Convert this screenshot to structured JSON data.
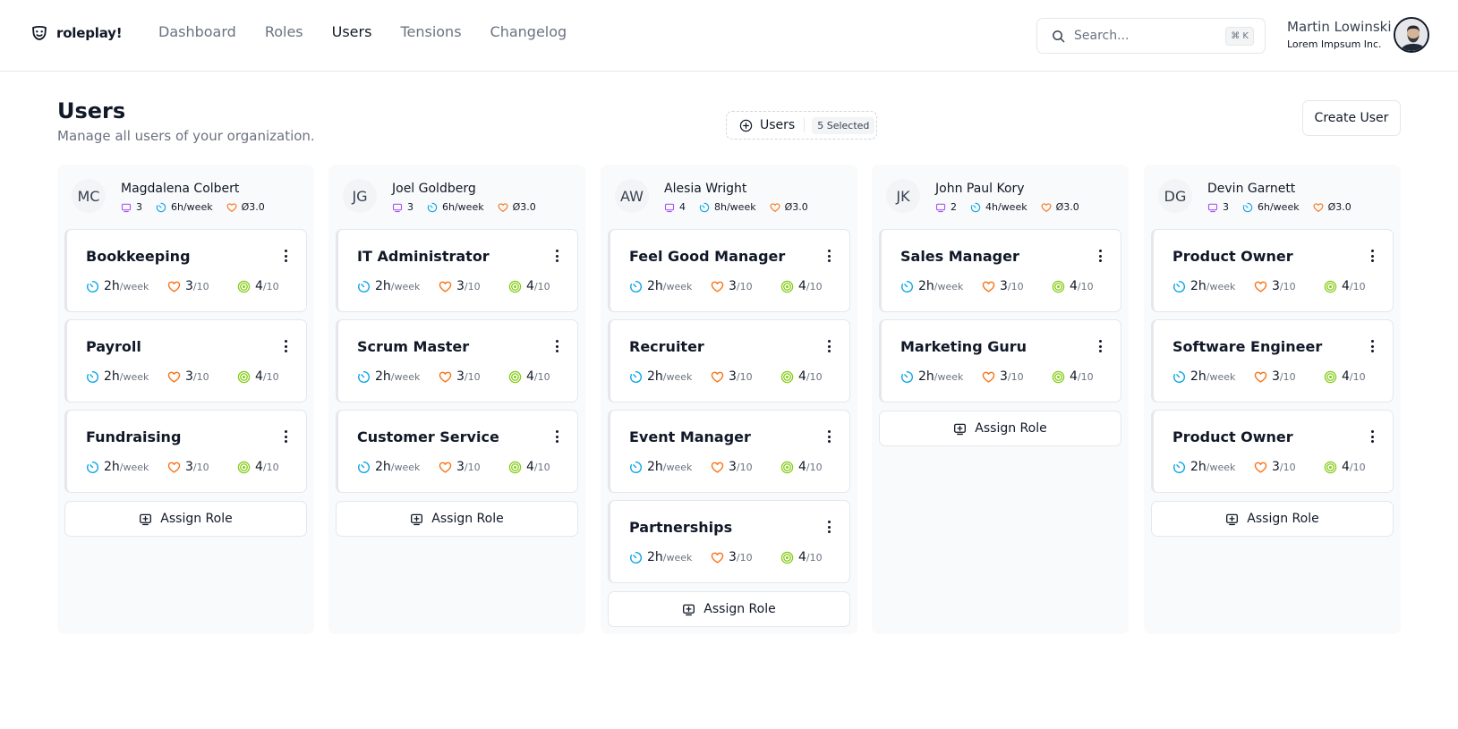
{
  "app": {
    "name": "roleplay!"
  },
  "nav": {
    "items": [
      {
        "label": "Dashboard"
      },
      {
        "label": "Roles"
      },
      {
        "label": "Users",
        "active": true
      },
      {
        "label": "Tensions"
      },
      {
        "label": "Changelog"
      }
    ]
  },
  "search": {
    "placeholder": "Search...",
    "shortcut": "⌘ K"
  },
  "current_user": {
    "name": "Martin Lowinski",
    "org": "Lorem Impsum Inc."
  },
  "page": {
    "title": "Users",
    "subtitle": "Manage all users of your organization.",
    "filter_label": "Users",
    "filter_badge": "5 Selected",
    "create_button": "Create User",
    "assign_label": "Assign Role"
  },
  "colors": {
    "roles_icon": "#a855f7",
    "time_icon": "#0ea5e9",
    "love_icon": "#f97316",
    "target_icon": "#84cc16"
  },
  "icons": {
    "logo": "mask-icon",
    "search": "search-icon",
    "filter": "plus-circle-icon",
    "roles": "roles-icon",
    "time": "clock-icon",
    "love": "heart-icon",
    "target": "target-icon",
    "menu": "more-vertical-icon",
    "assign": "assign-role-icon"
  },
  "columns": [
    {
      "initials": "MC",
      "name": "Magdalena Colbert",
      "role_count": "3",
      "hours": "6h/week",
      "avg": "Ø3.0",
      "roles": [
        {
          "title": "Bookkeeping",
          "hours": "2h",
          "unit": "/week",
          "love": "3",
          "love_max": "/10",
          "fit": "4",
          "fit_max": "/10"
        },
        {
          "title": "Payroll",
          "hours": "2h",
          "unit": "/week",
          "love": "3",
          "love_max": "/10",
          "fit": "4",
          "fit_max": "/10"
        },
        {
          "title": "Fundraising",
          "hours": "2h",
          "unit": "/week",
          "love": "3",
          "love_max": "/10",
          "fit": "4",
          "fit_max": "/10"
        }
      ]
    },
    {
      "initials": "JG",
      "name": "Joel Goldberg",
      "role_count": "3",
      "hours": "6h/week",
      "avg": "Ø3.0",
      "roles": [
        {
          "title": "IT Administrator",
          "hours": "2h",
          "unit": "/week",
          "love": "3",
          "love_max": "/10",
          "fit": "4",
          "fit_max": "/10"
        },
        {
          "title": "Scrum Master",
          "hours": "2h",
          "unit": "/week",
          "love": "3",
          "love_max": "/10",
          "fit": "4",
          "fit_max": "/10"
        },
        {
          "title": "Customer Service",
          "hours": "2h",
          "unit": "/week",
          "love": "3",
          "love_max": "/10",
          "fit": "4",
          "fit_max": "/10"
        }
      ]
    },
    {
      "initials": "AW",
      "name": "Alesia Wright",
      "role_count": "4",
      "hours": "8h/week",
      "avg": "Ø3.0",
      "roles": [
        {
          "title": "Feel Good Manager",
          "hours": "2h",
          "unit": "/week",
          "love": "3",
          "love_max": "/10",
          "fit": "4",
          "fit_max": "/10"
        },
        {
          "title": "Recruiter",
          "hours": "2h",
          "unit": "/week",
          "love": "3",
          "love_max": "/10",
          "fit": "4",
          "fit_max": "/10"
        },
        {
          "title": "Event Manager",
          "hours": "2h",
          "unit": "/week",
          "love": "3",
          "love_max": "/10",
          "fit": "4",
          "fit_max": "/10"
        },
        {
          "title": "Partnerships",
          "hours": "2h",
          "unit": "/week",
          "love": "3",
          "love_max": "/10",
          "fit": "4",
          "fit_max": "/10"
        }
      ]
    },
    {
      "initials": "JK",
      "name": "John Paul Kory",
      "role_count": "2",
      "hours": "4h/week",
      "avg": "Ø3.0",
      "roles": [
        {
          "title": "Sales Manager",
          "hours": "2h",
          "unit": "/week",
          "love": "3",
          "love_max": "/10",
          "fit": "4",
          "fit_max": "/10"
        },
        {
          "title": "Marketing Guru",
          "hours": "2h",
          "unit": "/week",
          "love": "3",
          "love_max": "/10",
          "fit": "4",
          "fit_max": "/10"
        }
      ]
    },
    {
      "initials": "DG",
      "name": "Devin Garnett",
      "role_count": "3",
      "hours": "6h/week",
      "avg": "Ø3.0",
      "roles": [
        {
          "title": "Product Owner",
          "hours": "2h",
          "unit": "/week",
          "love": "3",
          "love_max": "/10",
          "fit": "4",
          "fit_max": "/10"
        },
        {
          "title": "Software Engineer",
          "hours": "2h",
          "unit": "/week",
          "love": "3",
          "love_max": "/10",
          "fit": "4",
          "fit_max": "/10"
        },
        {
          "title": "Product Owner",
          "hours": "2h",
          "unit": "/week",
          "love": "3",
          "love_max": "/10",
          "fit": "4",
          "fit_max": "/10"
        }
      ]
    }
  ]
}
